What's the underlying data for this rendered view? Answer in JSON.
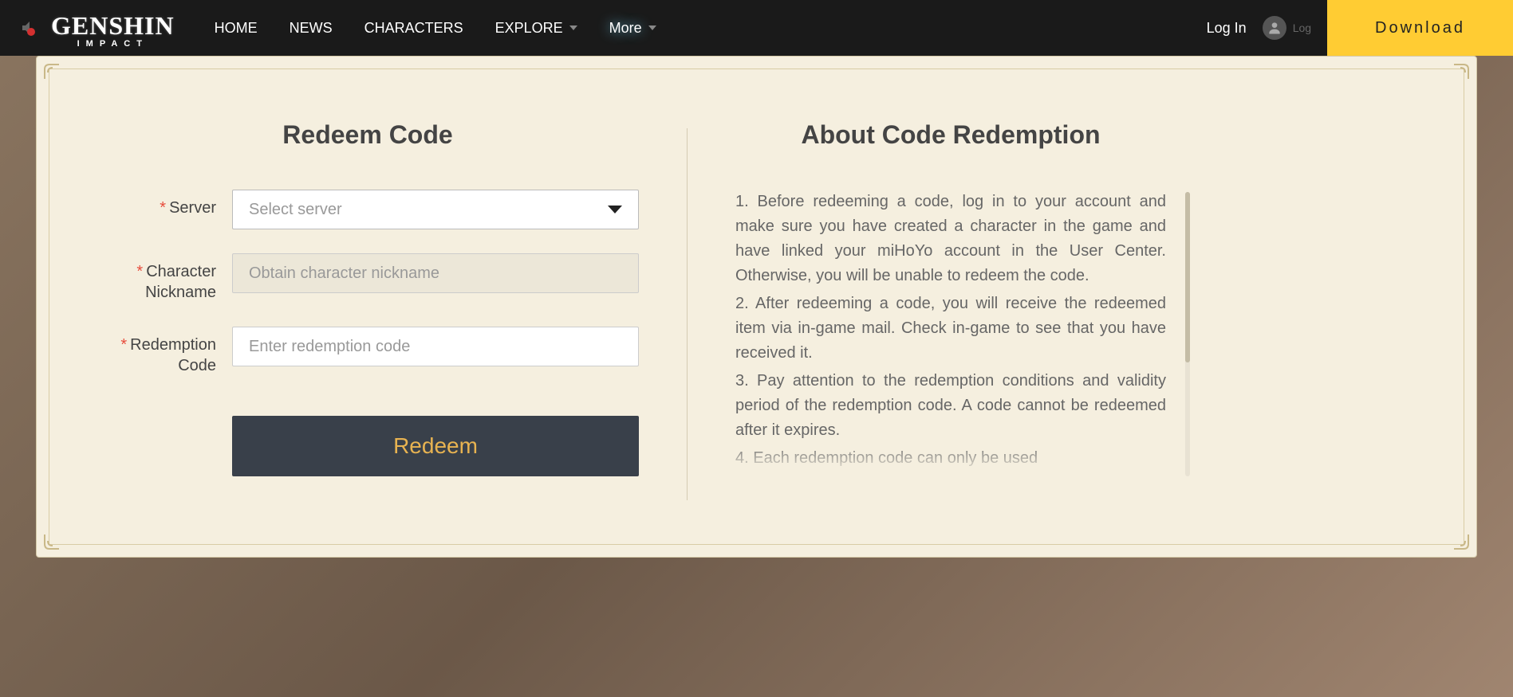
{
  "header": {
    "logo_main": "GENSHIN",
    "logo_sub": "IMPACT",
    "nav": [
      {
        "label": "HOME",
        "dropdown": false
      },
      {
        "label": "NEWS",
        "dropdown": false
      },
      {
        "label": "CHARACTERS",
        "dropdown": false
      },
      {
        "label": "EXPLORE",
        "dropdown": true
      },
      {
        "label": "More",
        "dropdown": true,
        "active": true
      }
    ],
    "login": "Log In",
    "avatar_hint": "Log",
    "download": "Download"
  },
  "form": {
    "title": "Redeem Code",
    "server_label": "Server",
    "server_placeholder": "Select server",
    "nickname_label": "Character Nickname",
    "nickname_placeholder": "Obtain character nickname",
    "code_label": "Redemption Code",
    "code_placeholder": "Enter redemption code",
    "submit": "Redeem"
  },
  "about": {
    "title": "About Code Redemption",
    "p1": "1. Before redeeming a code, log in to your account and make sure you have created a character in the game and have linked your miHoYo account in the User Center. Otherwise, you will be unable to redeem the code.",
    "p2": "2. After redeeming a code, you will receive the redeemed item via in-game mail. Check in-game to see that you have received it.",
    "p3": "3. Pay attention to the redemption conditions and validity period of the redemption code. A code cannot be redeemed after it expires.",
    "p4": "4. Each redemption code can only be used"
  }
}
